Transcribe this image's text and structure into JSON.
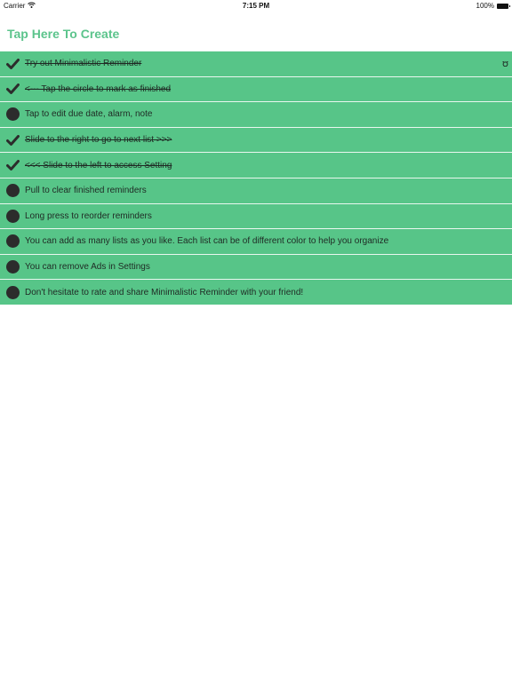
{
  "status_bar": {
    "carrier": "Carrier",
    "time": "7:15 PM",
    "battery": "100%"
  },
  "header": {
    "title": "Tap Here To Create"
  },
  "reminders": [
    {
      "text": "Try out Minimalistic Reminder",
      "done": true
    },
    {
      "text": "<--- Tap the circle to mark as finished",
      "done": true
    },
    {
      "text": "Tap to edit due date, alarm, note",
      "done": false
    },
    {
      "text": "Slide to the right to go to next list >>>",
      "done": true
    },
    {
      "text": "<<< Slide to the left to access Setting",
      "done": true
    },
    {
      "text": "Pull to clear finished reminders",
      "done": false
    },
    {
      "text": "Long press to reorder reminders",
      "done": false
    },
    {
      "text": "You can add as many lists as you like. Each list can be of different color to help you organize",
      "done": false
    },
    {
      "text": "You can remove Ads in Settings",
      "done": false
    },
    {
      "text": "Don't hesitate to rate and share Minimalistic Reminder with your friend!",
      "done": false
    }
  ],
  "icons": {
    "done_marker": "checkmark-icon",
    "open_marker": "circle-icon",
    "row_side_icons": [
      "alarm-icon",
      "note-icon"
    ]
  },
  "colors": {
    "accent": "#5cc48c",
    "row_background": "#57c588",
    "marker": "#2c2c2c"
  }
}
